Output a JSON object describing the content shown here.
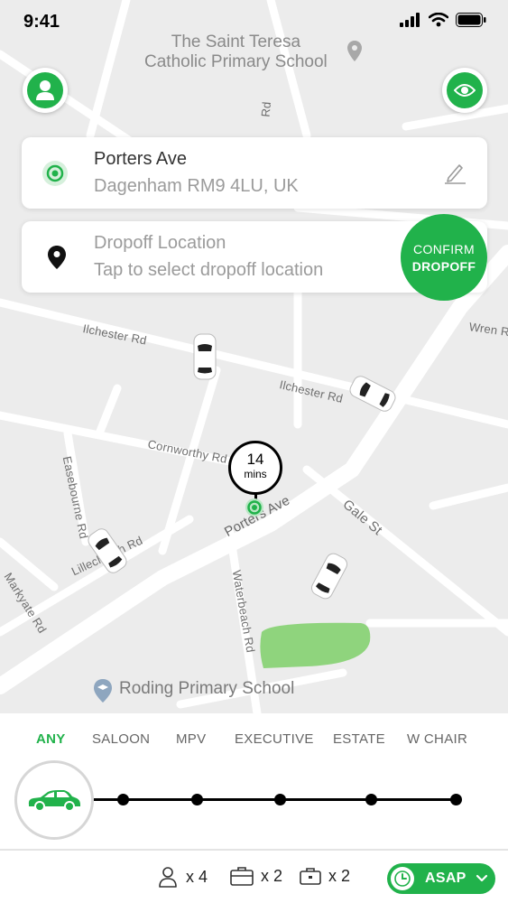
{
  "status_bar": {
    "time": "9:41"
  },
  "map": {
    "poi_school_top": "The Saint Teresa\nCatholic Primary School",
    "poi_school_bottom": "Roding Primary School",
    "roads": {
      "ilchester_1": "Ilchester Rd",
      "ilchester_2": "Ilchester Rd",
      "cornworthy": "Cornworthy Rd",
      "porters": "Porters Ave",
      "gale": "Gale St",
      "waterbeach": "Waterbeach Rd",
      "lillechurch": "Lillechurch Rd",
      "easebourne": "Easebourne Rd",
      "markyate": "Markyate Rd",
      "wren": "Wren Rd",
      "top_rd": "Rd"
    },
    "eta": {
      "value": "14",
      "unit": "mins"
    }
  },
  "pickup": {
    "title": "Porters Ave",
    "subtitle": "Dagenham RM9 4LU, UK"
  },
  "dropoff": {
    "title": "Dropoff Location",
    "subtitle": "Tap to select dropoff location"
  },
  "confirm_button": {
    "line1": "CONFIRM",
    "line2": "DROPOFF"
  },
  "vehicle_types": {
    "tabs": [
      "ANY",
      "SALOON",
      "MPV",
      "EXECUTIVE",
      "ESTATE",
      "W CHAIR"
    ],
    "selected": "ANY"
  },
  "capacity": {
    "passengers": "x 4",
    "luggage": "x 2",
    "hand_luggage": "x 2"
  },
  "asap_button": {
    "label": "ASAP"
  },
  "colors": {
    "accent": "#21b24b",
    "map_bg": "#ececec",
    "park": "#8fd47d"
  },
  "icons": [
    "person-icon",
    "eye-icon",
    "location-dot-icon",
    "pencil-icon",
    "map-pin-icon",
    "car-icon",
    "suitcase-icon",
    "briefcase-icon",
    "clock-icon",
    "chevron-down-icon"
  ]
}
